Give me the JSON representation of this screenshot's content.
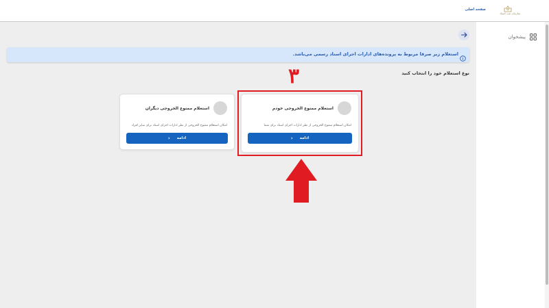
{
  "header": {
    "logo_text": "سازمان ثبت اسناد",
    "home_link": "صفحه اصلی"
  },
  "sidebar": {
    "items": [
      {
        "label": "پیشخوان",
        "icon": "grid-icon"
      }
    ]
  },
  "notice": {
    "text": "استعلام زیر صرفا مربوط به پرونده‌های ادارات اجرای اسناد رسمی می‌باشد.",
    "icon": "info-icon"
  },
  "section": {
    "label": "نوع استعلام خود را انتخاب کنید"
  },
  "annotation": {
    "step_number": "۳",
    "color": "#e01b22"
  },
  "cards": [
    {
      "title": "استعلام ممنوع الخروجی خودم",
      "description": "امکان استعلام ممنوع الخروجی از نظر ادارات اجرای اسناد برای شما",
      "button_label": "ادامه"
    },
    {
      "title": "استعلام ممنوع الخروجی دیگران",
      "description": "امکان استعلام ممنوع الخروجی از نظر ادارات اجرای اسناد برای سایر افراد",
      "button_label": "ادامه"
    }
  ],
  "colors": {
    "primary": "#1565c0",
    "notice_bg": "#d6e6fb",
    "notice_text": "#2a5bb0",
    "background": "#eeeeee"
  }
}
